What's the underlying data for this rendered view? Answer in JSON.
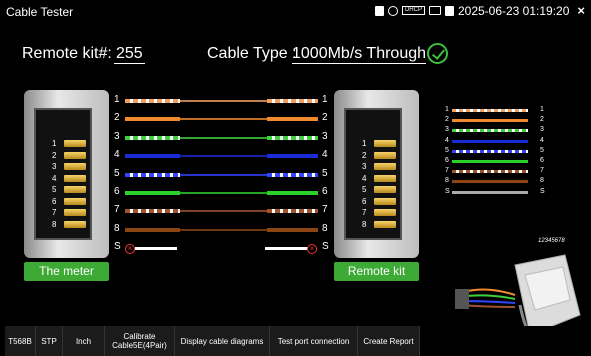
{
  "status": {
    "title": "Cable Tester",
    "datetime": "2025-06-23 01:19:20",
    "dhcp_label": "DHCP",
    "close_label": "×"
  },
  "header": {
    "remote_label": "Remote kit#:",
    "remote_value": "255",
    "cable_type_label": "Cable Type :",
    "cable_type_value": "1000Mb/s Through"
  },
  "ports": {
    "left_label": "The meter",
    "right_label": "Remote kit",
    "pin_numbers": [
      "1",
      "2",
      "3",
      "4",
      "5",
      "6",
      "7",
      "8"
    ]
  },
  "wires": [
    {
      "label": "1",
      "color": "#f0a060",
      "stripe": true
    },
    {
      "label": "2",
      "color": "#f08a30",
      "stripe": false
    },
    {
      "label": "3",
      "color": "#3fd03f",
      "stripe": true
    },
    {
      "label": "4",
      "color": "#1a2bd8",
      "stripe": false
    },
    {
      "label": "5",
      "color": "#3344ff",
      "stripe": true
    },
    {
      "label": "6",
      "color": "#2bd02b",
      "stripe": false
    },
    {
      "label": "7",
      "color": "#a0522d",
      "stripe": true
    },
    {
      "label": "8",
      "color": "#8b4513",
      "stripe": false
    },
    {
      "label": "S",
      "color": "#ffffff",
      "stripe": false
    }
  ],
  "connector_label": "12345678",
  "toolbar": [
    {
      "label": "T568B"
    },
    {
      "label": "STP"
    },
    {
      "label": "Inch"
    },
    {
      "label": "Calibrate Cable5E(4Pair)"
    },
    {
      "label": "Display cable diagrams"
    },
    {
      "label": "Test port connection"
    },
    {
      "label": "Create Report"
    }
  ]
}
